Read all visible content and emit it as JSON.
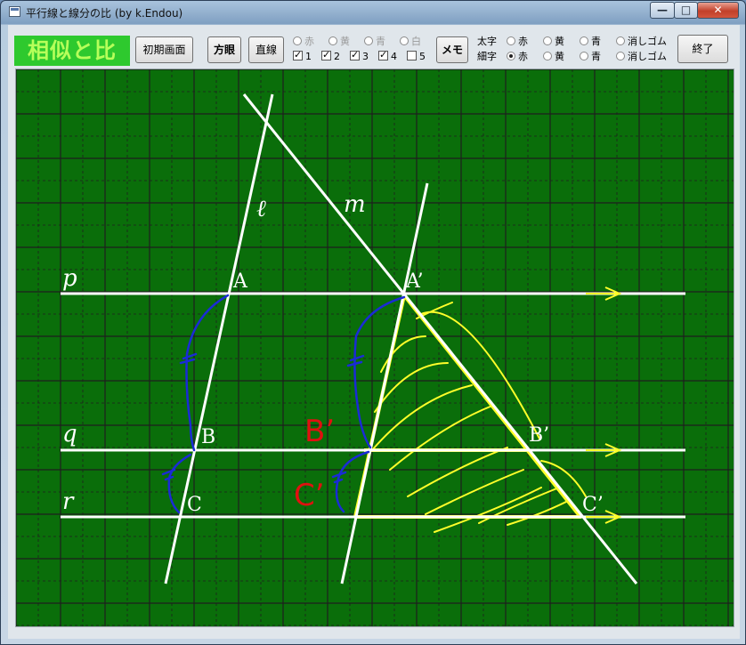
{
  "window": {
    "title": "平行線と線分の比 (by k.Endou)"
  },
  "title_buttons": {
    "minimize": "—",
    "maximize": "□",
    "close": "✕"
  },
  "header": {
    "logo_text": "相似と比"
  },
  "toolbar": {
    "reset_label": "初期画面",
    "grid_label": "方眼",
    "line_label": "直線",
    "memo_label": "メモ",
    "exit_label": "終了"
  },
  "line_colors": [
    "赤",
    "黄",
    "青",
    "白"
  ],
  "line_checks": [
    {
      "label": "1",
      "checked": true
    },
    {
      "label": "2",
      "checked": true
    },
    {
      "label": "3",
      "checked": true
    },
    {
      "label": "4",
      "checked": true
    },
    {
      "label": "5",
      "checked": false
    }
  ],
  "pen": {
    "thick_label": "太字",
    "thin_label": "細字",
    "colors": [
      "赤",
      "黄",
      "青"
    ],
    "eraser": "消しゴム",
    "selected_thin": "赤"
  },
  "drawing": {
    "points": {
      "A": "A",
      "B": "B",
      "C": "C",
      "A2": "A’",
      "B2": "B’",
      "C2": "C’"
    },
    "lines": {
      "p": "p",
      "q": "q",
      "r": "r",
      "l": "ℓ",
      "m": "m"
    },
    "red_notes": {
      "b": "B’",
      "c": "C’"
    },
    "colors": {
      "board": "#0a6e0a",
      "grid": "#1f1f1f",
      "white": "#ffffff",
      "yellow": "#ffff2a",
      "blue": "#1a2bd6",
      "red": "#e01010"
    }
  }
}
